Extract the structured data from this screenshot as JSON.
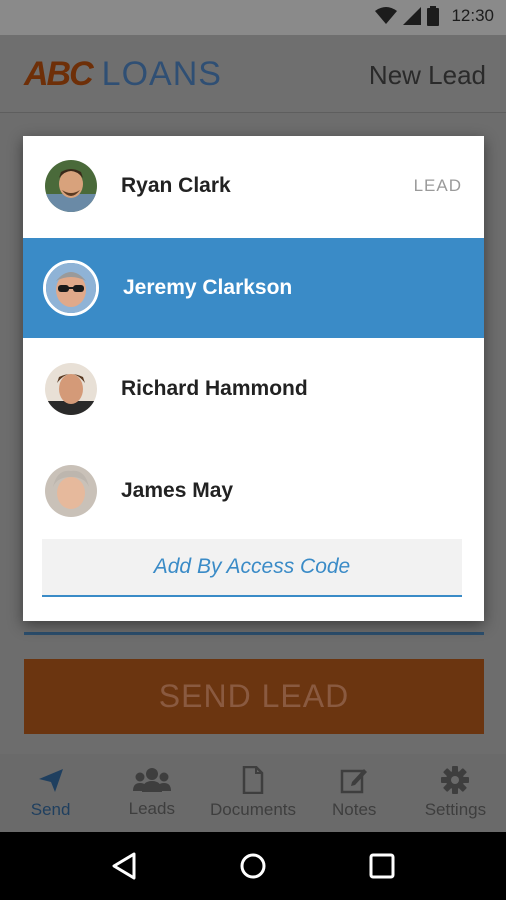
{
  "status_bar": {
    "time": "12:30",
    "icons": [
      "wifi-icon",
      "signal-icon",
      "battery-icon"
    ]
  },
  "header": {
    "logo_abc": "ABC",
    "logo_loans": "LOANS",
    "title": "New Lead"
  },
  "main": {
    "send_lead_label": "SEND LEAD"
  },
  "dialog": {
    "contacts": [
      {
        "name": "Ryan Clark",
        "tag": "LEAD",
        "selected": false
      },
      {
        "name": "Jeremy Clarkson",
        "tag": "",
        "selected": true
      },
      {
        "name": "Richard Hammond",
        "tag": "",
        "selected": false
      },
      {
        "name": "James May",
        "tag": "",
        "selected": false
      }
    ],
    "access_code_label": "Add By Access Code"
  },
  "bottom_nav": {
    "items": [
      {
        "label": "Send",
        "icon": "send-icon",
        "active": true
      },
      {
        "label": "Leads",
        "icon": "leads-icon",
        "active": false
      },
      {
        "label": "Documents",
        "icon": "document-icon",
        "active": false
      },
      {
        "label": "Notes",
        "icon": "notes-icon",
        "active": false
      },
      {
        "label": "Settings",
        "icon": "settings-icon",
        "active": false
      }
    ]
  },
  "colors": {
    "selected_row": "#3a8bc7",
    "accent_blue": "#3a8bc7",
    "send_button": "#c0581a"
  }
}
